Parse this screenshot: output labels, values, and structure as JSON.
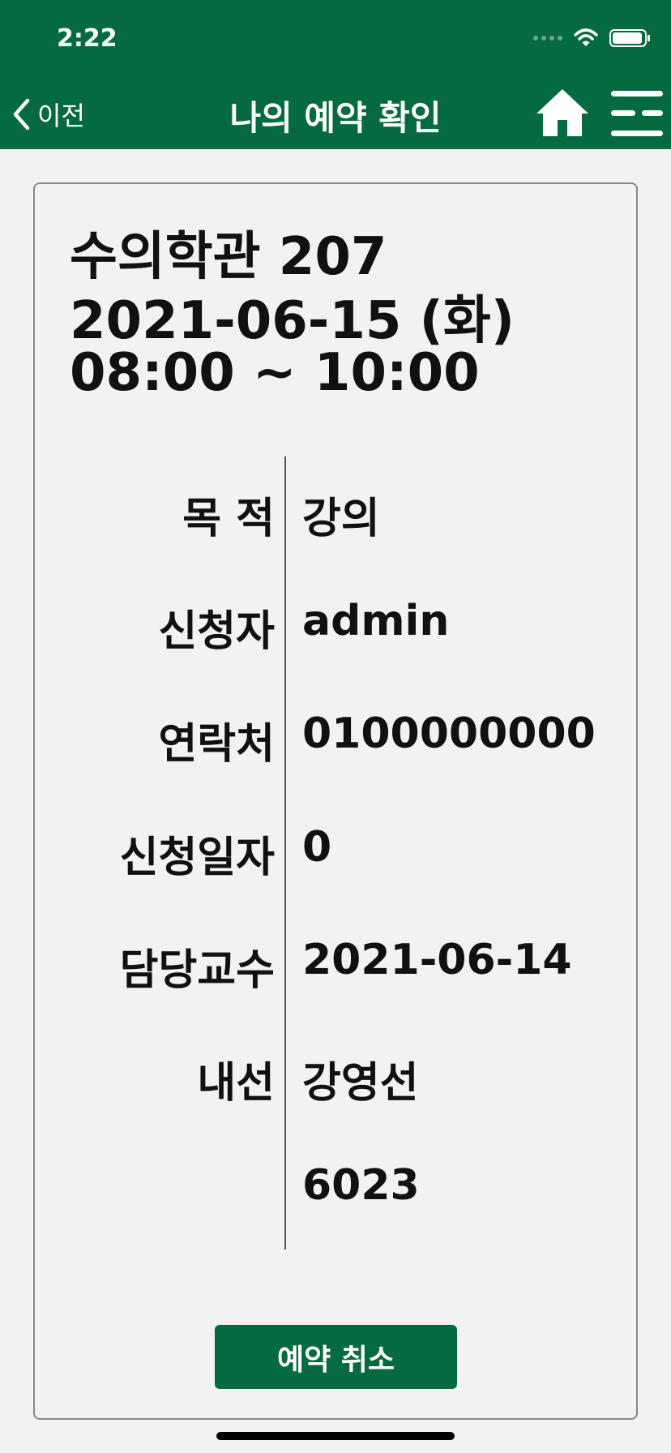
{
  "status_bar": {
    "time": "2:22",
    "battery_level": 0.95
  },
  "nav": {
    "back_label": "이전",
    "title": "나의 예약 확인"
  },
  "reservation": {
    "room": "수의학관 207",
    "date": "2021-06-15 (화)",
    "time_range": "08:00 ~ 10:00",
    "rows": [
      {
        "label": "목 적",
        "value": "강의"
      },
      {
        "label": "신청자",
        "value": "admin"
      },
      {
        "label": "연락처",
        "value": "0100000000"
      },
      {
        "label": "신청일자",
        "value": "0"
      },
      {
        "label": "담당교수",
        "value": "2021-06-14"
      },
      {
        "label": "내선",
        "value": "강영선"
      },
      {
        "label": "",
        "value": "6023"
      }
    ]
  },
  "actions": {
    "cancel_label": "예약 취소"
  },
  "colors": {
    "brand_green": "#066a3f",
    "background": "#f2f2f2"
  },
  "icons": [
    "wifi-icon",
    "battery-icon",
    "chevron-left-icon",
    "home-icon",
    "menu-icon"
  ]
}
